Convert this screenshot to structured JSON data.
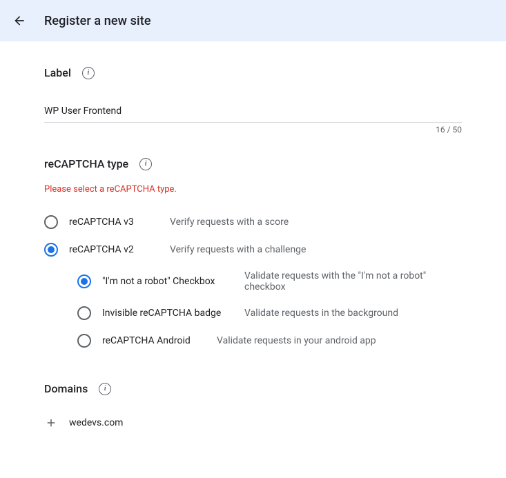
{
  "header": {
    "title": "Register a new site"
  },
  "label": {
    "section_title": "Label",
    "value": "WP User Frontend",
    "char_count": "16 / 50"
  },
  "recaptcha": {
    "section_title": "reCAPTCHA type",
    "error": "Please select a reCAPTCHA type.",
    "options": {
      "v3": {
        "label": "reCAPTCHA v3",
        "hint": "Verify requests with a score"
      },
      "v2": {
        "label": "reCAPTCHA v2",
        "hint": "Verify requests with a challenge",
        "sub": {
          "checkbox": {
            "label": "\"I'm not a robot\" Checkbox",
            "hint": "Validate requests with the \"I'm not a robot\" checkbox"
          },
          "invisible": {
            "label": "Invisible reCAPTCHA badge",
            "hint": "Validate requests in the background"
          },
          "android": {
            "label": "reCAPTCHA Android",
            "hint": "Validate requests in your android app"
          }
        }
      }
    }
  },
  "domains": {
    "section_title": "Domains",
    "items": {
      "first": "wedevs.com"
    }
  }
}
